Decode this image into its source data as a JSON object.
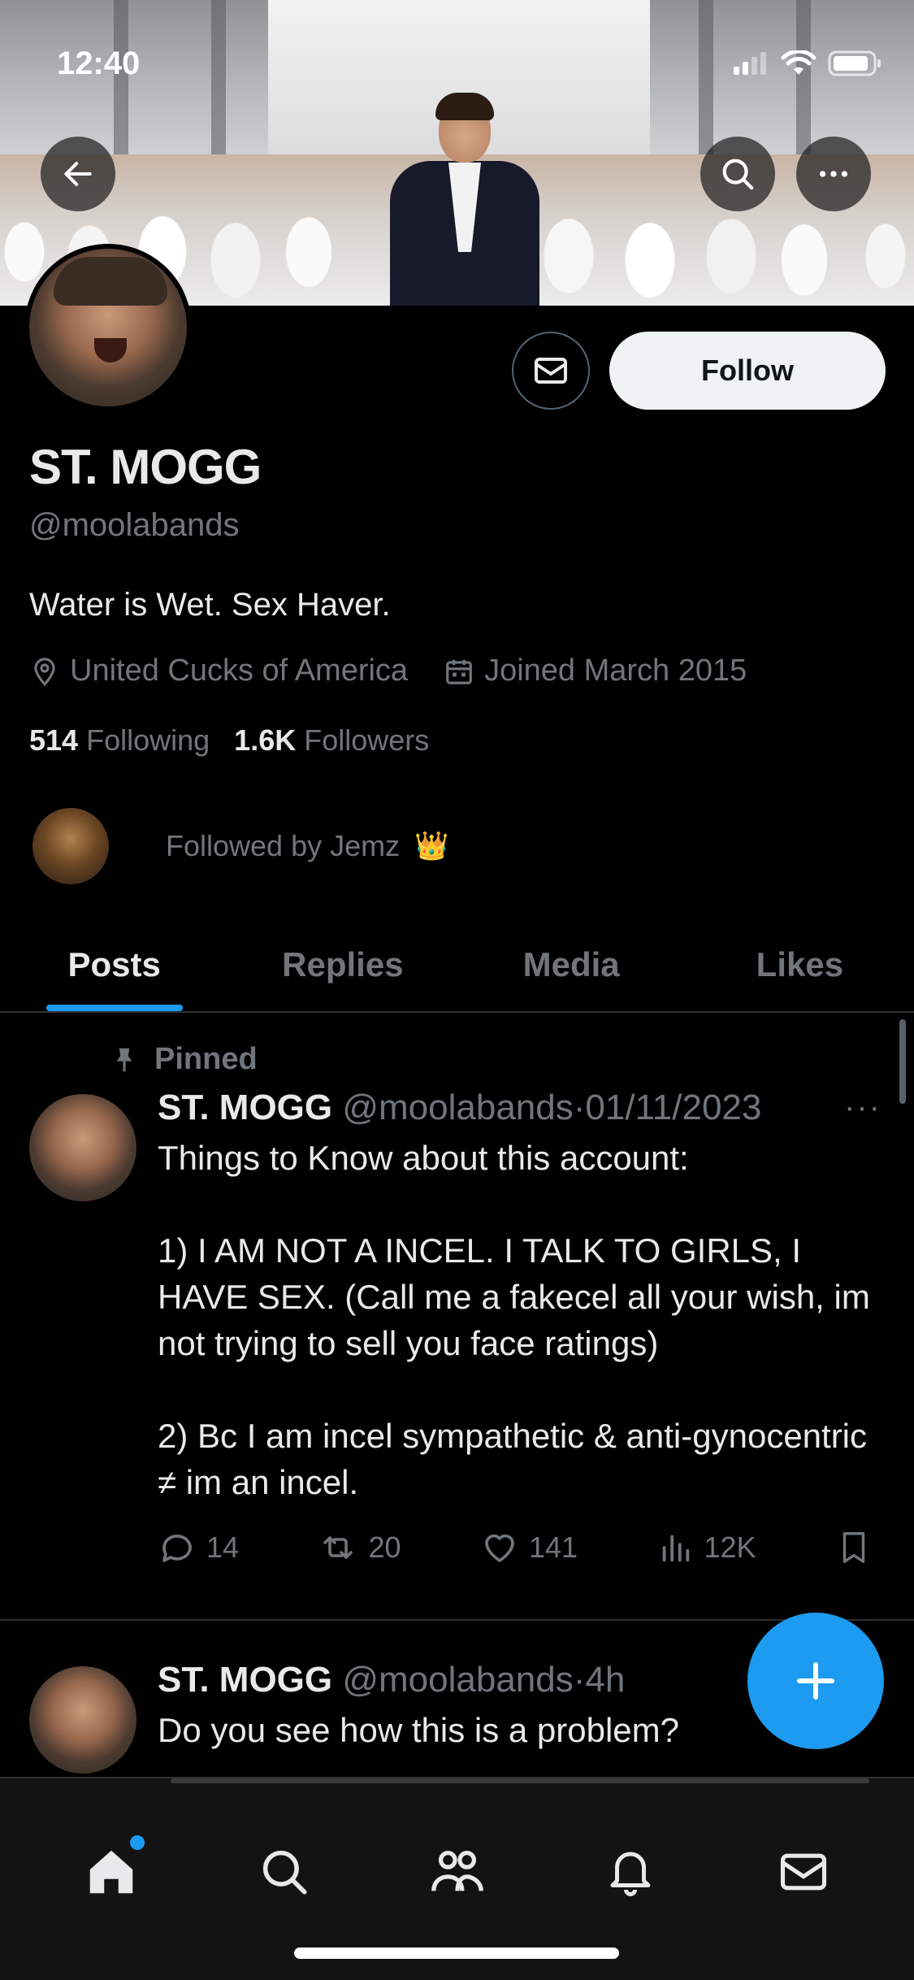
{
  "status_bar": {
    "time": "12:40"
  },
  "profile": {
    "display_name": "ST. MOGG",
    "handle": "@moolabands",
    "bio": "Water is Wet. Sex Haver.",
    "location": "United Cucks of America",
    "joined": "Joined March 2015",
    "following_count": "514",
    "following_label": "Following",
    "followers_count": "1.6K",
    "followers_label": "Followers",
    "followed_by": "Followed by Jemz",
    "follow_label": "Follow"
  },
  "tabs": [
    "Posts",
    "Replies",
    "Media",
    "Likes"
  ],
  "active_tab": "Posts",
  "posts": [
    {
      "pinned_label": "Pinned",
      "name": "ST. MOGG",
      "handle": "@moolabands",
      "sep": "·",
      "time": "01/11/2023",
      "more": "···",
      "paragraphs": [
        "Things to Know about this account:",
        "1) I AM NOT A INCEL. I TALK TO GIRLS, I HAVE SEX. (Call me a fakecel all your wish, im not trying to sell you face ratings)",
        "2) Bc I am incel sympathetic & anti-gynocentric ≠ im an incel."
      ],
      "replies": "14",
      "reposts": "20",
      "likes": "141",
      "views": "12K"
    },
    {
      "name": "ST. MOGG",
      "handle": "@moolabands",
      "sep": "·",
      "time": "4h",
      "text": "Do you see how this is a problem?"
    }
  ],
  "colors": {
    "accent": "#1d9bf0",
    "muted": "#71767b",
    "text": "#e7e9ea",
    "bg": "#000000",
    "divider": "#2f3336"
  },
  "icons": {
    "back": "arrow-left-icon",
    "search": "search-icon",
    "more": "more-horizontal-icon",
    "message": "envelope-icon",
    "location": "location-pin-icon",
    "calendar": "calendar-icon",
    "pin": "pin-icon",
    "reply": "comment-icon",
    "repost": "repost-icon",
    "like": "heart-icon",
    "views": "bar-chart-icon",
    "bookmark": "bookmark-icon",
    "compose": "plus-icon",
    "nav_home": "home-icon",
    "nav_search": "search-icon",
    "nav_communities": "people-icon",
    "nav_notifications": "bell-icon",
    "nav_messages": "envelope-icon"
  }
}
